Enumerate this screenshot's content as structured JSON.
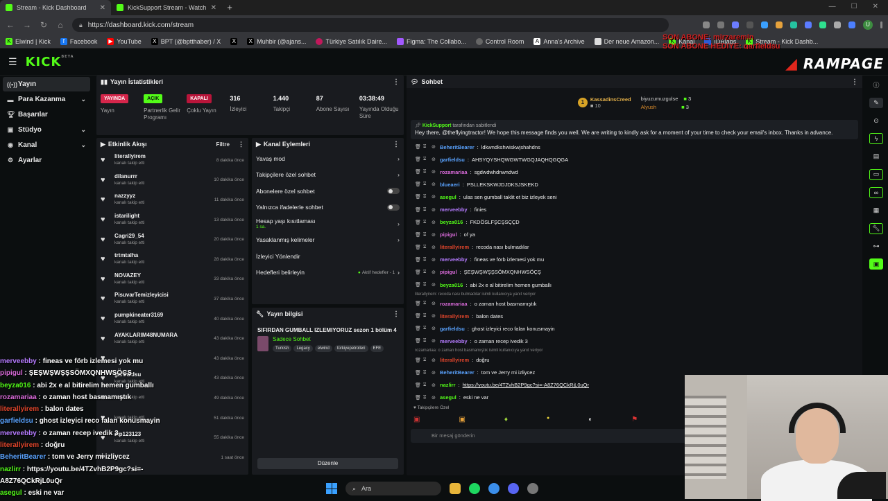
{
  "browser": {
    "tabs": [
      {
        "label": "Stream - Kick Dashboard",
        "active": true
      },
      {
        "label": "KickSupport Stream - Watch Live",
        "active": false
      }
    ],
    "url": "https://dashboard.kick.com/stream",
    "bookmarks": [
      "Elwind | Kick",
      "Facebook",
      "YouTube",
      "BPT (@bptthaber) / X",
      "",
      "Muhbir (@ajans...",
      "Türkiye Satılık Daire...",
      "Figma: The Collabo...",
      "Control Room",
      "Anna's Archive",
      "Der neue Amazon...",
      "Kanal",
      "IDRlabs",
      "Stream - Kick Dashb..."
    ]
  },
  "overlay_sub": [
    "SON ABONE: mirzaremin",
    "SON ABONE HEDIYE: garfieldsu"
  ],
  "brand": {
    "logo": "KICK",
    "beta": "BETA",
    "overlay_logo": "RAMPAGE",
    "accent": "#53fc18"
  },
  "sidebar": {
    "items": [
      {
        "label": "Yayın",
        "active": true,
        "chev": false
      },
      {
        "label": "Para Kazanma",
        "chev": true
      },
      {
        "label": "Başarılar",
        "chev": false
      },
      {
        "label": "Stüdyo",
        "chev": true
      },
      {
        "label": "Kanal",
        "chev": true
      },
      {
        "label": "Ayarlar",
        "chev": false
      }
    ]
  },
  "stats": {
    "title": "Yayın İstatistikleri",
    "items": [
      {
        "badge": "YAYINDA",
        "label": "Yayın"
      },
      {
        "badge": "AÇIK",
        "label": "Partnerlik Gelir Programı"
      },
      {
        "badge": "KAPALI",
        "label": "Çoklu Yayın"
      },
      {
        "value": "316",
        "label": "İzleyici"
      },
      {
        "value": "1.440",
        "label": "Takipçi"
      },
      {
        "value": "87",
        "label": "Abone Sayısı"
      },
      {
        "value": "03:38:49",
        "label": "Yayında Olduğu Süre"
      }
    ]
  },
  "activity": {
    "title": "Etkinlik Akışı",
    "filter": "Filtre",
    "items": [
      {
        "name": "literallyirem",
        "sub": "kanalı takip etti",
        "time": "8 dakika önce"
      },
      {
        "name": "dilanurrr",
        "sub": "kanalı takip etti",
        "time": "10 dakika önce"
      },
      {
        "name": "nazzyyz",
        "sub": "kanalı takip etti",
        "time": "11 dakika önce"
      },
      {
        "name": "istarilight",
        "sub": "kanalı takip etti",
        "time": "13 dakika önce"
      },
      {
        "name": "Cagri29_54",
        "sub": "kanalı takip etti",
        "time": "20 dakika önce"
      },
      {
        "name": "trtmtalha",
        "sub": "kanalı takip etti",
        "time": "28 dakika önce"
      },
      {
        "name": "NOVAZEY",
        "sub": "kanalı takip etti",
        "time": "33 dakika önce"
      },
      {
        "name": "PisuvarTemizleyicisi",
        "sub": "kanalı takip etti",
        "time": "37 dakika önce"
      },
      {
        "name": "pumpkineater3169",
        "sub": "kanalı takip etti",
        "time": "40 dakika önce"
      },
      {
        "name": "AYAKLARIM48NUMARA",
        "sub": "kanalı takip etti",
        "time": "43 dakika önce"
      },
      {
        "name": "",
        "sub": "",
        "time": "43 dakika önce"
      },
      {
        "name": "garfieldsu",
        "sub": "kanalı takip etti",
        "time": "43 dakika önce"
      },
      {
        "name": "",
        "sub": "kanalı takip etti",
        "time": "49 dakika önce"
      },
      {
        "name": "",
        "sub": "kanalı takip etti",
        "time": "51 dakika önce"
      },
      {
        "name": "alp123123",
        "sub": "kanalı takip etti",
        "time": "55 dakika önce"
      },
      {
        "name": "",
        "sub": "",
        "time": "1 saat önce"
      }
    ]
  },
  "kanal": {
    "title": "Kanal Eylemleri",
    "items": [
      {
        "label": "Yavaş mod",
        "right": "chev"
      },
      {
        "label": "Takipçilere özel sohbet",
        "right": "chev"
      },
      {
        "label": "Abonelere özel sohbet",
        "right": "toggle"
      },
      {
        "label": "Yalnızca ifadelerle sohbet",
        "right": "toggle"
      },
      {
        "label": "Hesap yaşı kısıtlaması",
        "sub": "1 sa.",
        "right": "chev"
      },
      {
        "label": "Yasaklanmış kelimeler",
        "right": "chev"
      },
      {
        "label": "İzleyici Yönlendir",
        "right": ""
      },
      {
        "label": "Hedefleri belirleyin",
        "right": "hedef"
      }
    ],
    "hedef_status": "Aktif hedefler - 1"
  },
  "yayin": {
    "title": "Yayın bilgisi",
    "stream_title": "SIFIRDAN GUMBALL IZLEMIYORUZ sezon 1 bölüm 4",
    "category": "Sadece Sohbet",
    "tags": [
      "Turkish",
      "Legacy",
      "elwind",
      "türkiyepetrolleri",
      "EFE"
    ],
    "edit": "Düzenle"
  },
  "chat": {
    "title": "Sohbet",
    "top": [
      {
        "name": "KassadinsCreed",
        "count": "10"
      },
      {
        "name": "biyuzumuzgulse",
        "count": "3"
      },
      {
        "name": "Alyush",
        "count": "3"
      }
    ],
    "pinned_by": "KickSupport",
    "pinned_suffix": "tarafından sabitlendi",
    "pinned_msg": "Hey there, @theflyingtractor! We hope this message finds you well. We are writing to kindly ask for a moment of your time to check your email's inbox. Thanks in advance.",
    "messages": [
      {
        "user": "BeheritBearer",
        "color": "#5aa3ff",
        "text": "ldkwndkshwiskwjshahdns"
      },
      {
        "user": "garfieldsu",
        "color": "#5aa3ff",
        "text": "AHSYQYSHQWGWTWGQJAQHQGQGA"
      },
      {
        "user": "rozamariaa",
        "color": "#d96ad9",
        "text": "sgdwdwhdnwndwd"
      },
      {
        "user": "blueaeri",
        "color": "#5aa3ff",
        "text": "PSLLEKSKWJDJDKSJSKEKD"
      },
      {
        "user": "asegul",
        "color": "#53fc18",
        "text": "ulas sen gumball taklit et biz izleyek seni"
      },
      {
        "user": "merveebby",
        "color": "#b57bff",
        "text": "finies"
      },
      {
        "user": "beyza016",
        "color": "#53fc18",
        "text": "FKDÖSLFŞCŞSÇÇD"
      },
      {
        "user": "pipigul",
        "color": "#d96ad9",
        "text": "of ya"
      },
      {
        "user": "literallyirem",
        "color": "#e0452b",
        "text": "recoda nası bulmadılar"
      },
      {
        "user": "merveebby",
        "color": "#b57bff",
        "text": "fineas ve förb izlemesi yok mu"
      },
      {
        "user": "pipigul",
        "color": "#d96ad9",
        "text": "ŞEŞWŞWŞŞSÖMXQNHWSÖÇŞ"
      },
      {
        "user": "beyza016",
        "color": "#53fc18",
        "text": "abi 2x e al bitirelim hemen gumballı"
      },
      {
        "reply": "literallyirem: recoda nası bulmadılar isimli kullanıcıya yanıt veriyor"
      },
      {
        "user": "rozamariaa",
        "color": "#d96ad9",
        "text": "o zaman host basmamıştık"
      },
      {
        "user": "literallyirem",
        "color": "#e0452b",
        "text": "balon dates"
      },
      {
        "user": "garfieldsu",
        "color": "#5aa3ff",
        "text": "ghost izleyici reco falan konusmayin"
      },
      {
        "user": "merveebby",
        "color": "#b57bff",
        "text": "o zaman recep ivedik 3"
      },
      {
        "reply": "rozamariaa: o zaman host basmamıştık isimli kullanıcıya yanıt veriyor"
      },
      {
        "user": "literallyirem",
        "color": "#e0452b",
        "text": "doğru"
      },
      {
        "user": "BeheritBearer",
        "color": "#5aa3ff",
        "text": "tom ve Jerry mi izliycez"
      },
      {
        "user": "nazlirr",
        "color": "#53fc18",
        "text": "https://youtu.be/4TZvhB2P9gc?si=-A8Z76QCkRjL0uQr"
      },
      {
        "user": "asegul",
        "color": "#53fc18",
        "text": "eski ne var"
      }
    ],
    "follower_only": "Takipçilere Özel",
    "input_placeholder": "Bir mesaj gönderin"
  },
  "overlay_chat": [
    {
      "user": "merveebby",
      "color": "#b57bff",
      "text": "fineas ve förb izlemesi yok mu"
    },
    {
      "user": "pipigul",
      "color": "#d96ad9",
      "text": "ŞEŞWŞWŞŞSÖMXQNHWSÖÇŞ"
    },
    {
      "user": "beyza016",
      "color": "#53fc18",
      "text": "abi 2x e al bitirelim hemen gumballı"
    },
    {
      "user": "rozamariaa",
      "color": "#d96ad9",
      "text": "o zaman host basmamıştık"
    },
    {
      "user": "literallyirem",
      "color": "#e0452b",
      "text": "balon dates"
    },
    {
      "user": "garfieldsu",
      "color": "#5aa3ff",
      "text": "ghost izleyici reco falan konusmayin"
    },
    {
      "user": "merveebby",
      "color": "#b57bff",
      "text": "o zaman recep ivedik 3"
    },
    {
      "user": "literallyirem",
      "color": "#e0452b",
      "text": "doğru"
    },
    {
      "user": "BeheritBearer",
      "color": "#5aa3ff",
      "text": "tom ve Jerry mi izliycez"
    },
    {
      "user": "nazlirr",
      "color": "#53fc18",
      "text": "https://youtu.be/4TZvhB2P9gc?si=-"
    },
    {
      "user": "",
      "color": "#ffffff",
      "text": "A8Z76QCkRjL0uQr"
    },
    {
      "user": "asegul",
      "color": "#53fc18",
      "text": "eski ne var"
    }
  ],
  "taskbar": {
    "search": "Ara"
  }
}
